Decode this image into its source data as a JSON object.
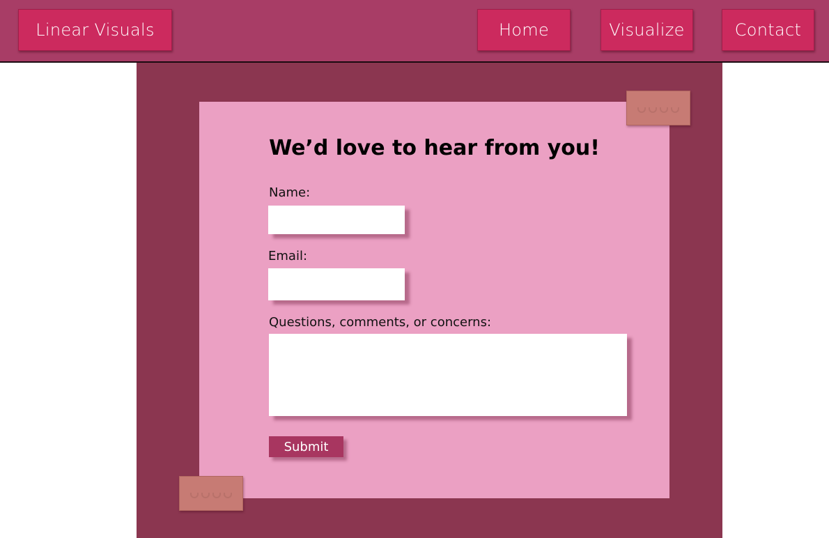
{
  "navbar": {
    "brand": "Linear Visuals",
    "links": [
      "Home",
      "Visualize",
      "Contact"
    ]
  },
  "form": {
    "title": "We’d love to hear from you!",
    "name_label": "Name:",
    "email_label": "Email:",
    "questions_label": "Questions, comments, or concerns:",
    "name_value": "",
    "email_value": "",
    "questions_value": "",
    "submit_label": "Submit"
  },
  "colors": {
    "navbar_bg": "#a83d66",
    "nav_button": "#cc2a5e",
    "backdrop": "#8b3650",
    "card": "#eba0c3",
    "tape": "#c77b74",
    "submit": "#a83660"
  }
}
